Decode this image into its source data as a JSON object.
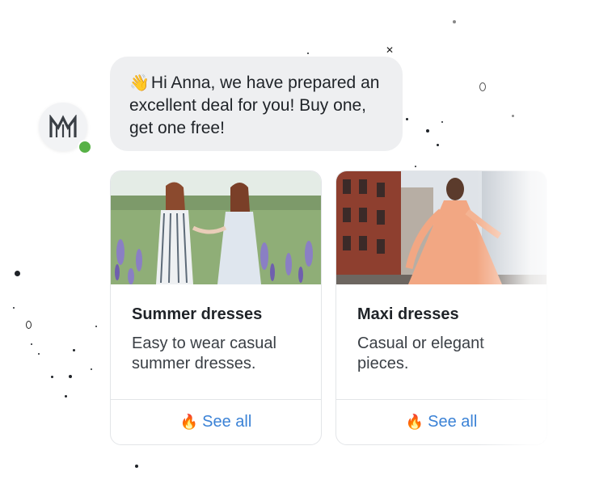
{
  "chat": {
    "message_emoji": "👋",
    "message_text": "Hi Anna, we have prepared an excellent deal for you! Buy one, get one free!",
    "avatar_icon": "brand-logo-m",
    "online_status_color": "#57b146"
  },
  "cards": [
    {
      "title": "Summer dresses",
      "description": "Easy to wear casual summer dresses.",
      "link_emoji": "🔥",
      "link_label": "See all",
      "image": "two-women-in-lupine-field"
    },
    {
      "title": "Maxi dresses",
      "description": "Casual or elegant pieces.",
      "link_emoji": "🔥",
      "link_label": "See all",
      "image": "woman-in-orange-maxi-dress-on-street"
    }
  ],
  "colors": {
    "bubble_bg": "#eeeff1",
    "link": "#3b82d6",
    "text": "#1f2328"
  }
}
